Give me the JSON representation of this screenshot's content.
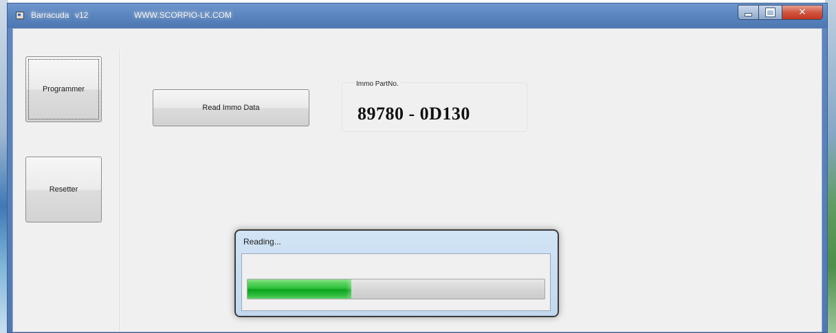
{
  "window": {
    "app_name": "Barracuda",
    "version": "v12",
    "website": "WWW.SCORPIO-LK.COM"
  },
  "sidebar": {
    "programmer_label": "Programmer",
    "resetter_label": "Resetter"
  },
  "main": {
    "read_button_label": "Read Immo Data",
    "immo_label": "Immo PartNo.",
    "immo_value": "89780 - 0D130"
  },
  "dialog": {
    "title": "Reading...",
    "progress_percent": 35
  },
  "colors": {
    "progress_fill": "#1fb52d",
    "titlebar": "#5a85bf",
    "close_button": "#c8432c"
  },
  "icons": {
    "app": "app-icon",
    "minimize": "minimize-icon",
    "maximize": "maximize-icon",
    "close": "close-icon"
  }
}
